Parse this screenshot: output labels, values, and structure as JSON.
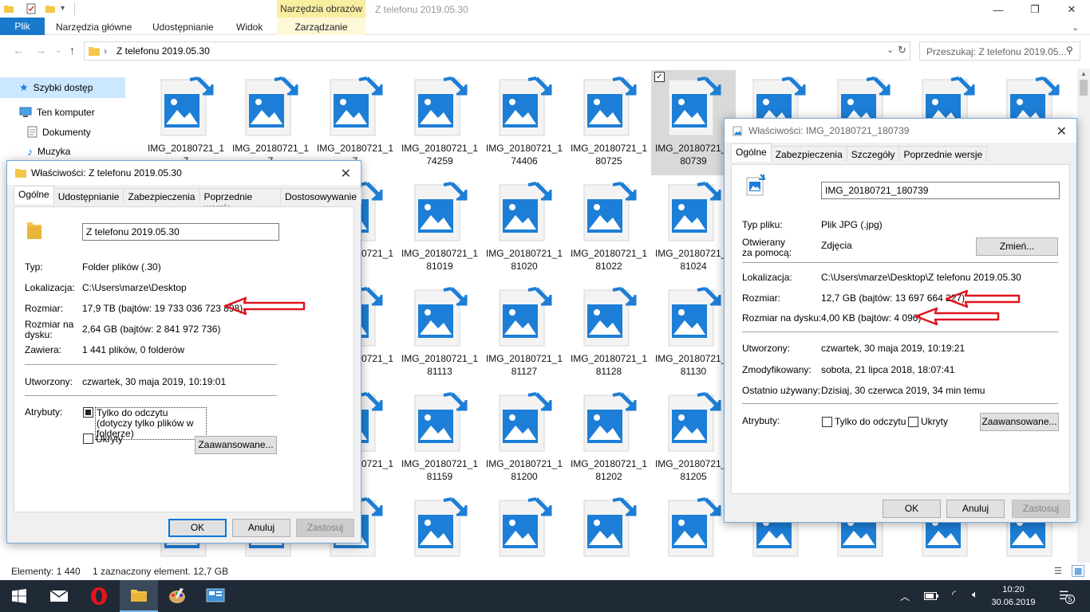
{
  "window": {
    "title": "Z telefonu 2019.05.30",
    "contextual_group": "Narzędzia obrazów",
    "contextual_tab": "Zarządzanie",
    "minimize": "—",
    "maximize": "❐",
    "close": "✕"
  },
  "ribbon": {
    "tabs": [
      "Plik",
      "Narzędzia główne",
      "Udostępnianie",
      "Widok"
    ]
  },
  "nav": {
    "address": "Z telefonu 2019.05.30",
    "search_placeholder": "Przeszukaj: Z telefonu 2019.05..."
  },
  "sidebar": {
    "items": [
      "Szybki dostęp",
      "Ten komputer",
      "Dokumenty",
      "Muzyka"
    ]
  },
  "files": [
    [
      "IMG_20180721_17",
      "IMG_20180721_17",
      "IMG_20180721_17",
      "IMG_20180721_174259",
      "IMG_20180721_174406",
      "IMG_20180721_180725",
      "IMG_20180721_180739",
      "",
      "",
      "",
      ""
    ],
    [
      "",
      "",
      "",
      "IMG_20180721_181019",
      "IMG_20180721_181020",
      "IMG_20180721_181022",
      "IMG_20180721_181024",
      "",
      "",
      "",
      ""
    ],
    [
      "",
      "",
      "",
      "IMG_20180721_181113",
      "IMG_20180721_181127",
      "IMG_20180721_181128",
      "IMG_20180721_181130",
      "",
      "",
      "",
      ""
    ],
    [
      "",
      "",
      "",
      "IMG_20180721_181159",
      "IMG_20180721_181200",
      "IMG_20180721_181202",
      "IMG_20180721_181205",
      "",
      "",
      "",
      ""
    ],
    [
      "",
      "",
      "",
      "",
      "",
      "",
      "",
      "",
      "",
      "",
      ""
    ]
  ],
  "partial_names": {
    "row2": "IMG_20180721_18",
    "row3": "IMG_20180721_18",
    "row4": "IMG_20180721_18"
  },
  "status": {
    "count": "Elementy: 1 440",
    "selection": "1 zaznaczony element. 12,7 GB"
  },
  "taskbar": {
    "time": "10:20",
    "date": "30.06.2019",
    "notifications": "5"
  },
  "folder_dialog": {
    "title": "Właściwości: Z telefonu 2019.05.30",
    "tabs": [
      "Ogólne",
      "Udostępnianie",
      "Zabezpieczenia",
      "Poprzednie wersje",
      "Dostosowywanie"
    ],
    "name": "Z telefonu 2019.05.30",
    "type_label": "Typ:",
    "type_value": "Folder plików (.30)",
    "location_label": "Lokalizacja:",
    "location_value": "C:\\Users\\marze\\Desktop",
    "size_label": "Rozmiar:",
    "size_value": "17,9 TB (bajtów: 19 733 036 723 898)",
    "disk_size_label": "Rozmiar na dysku:",
    "disk_size_value": "2,64 GB (bajtów: 2 841 972 736)",
    "contains_label": "Zawiera:",
    "contains_value": "1 441 plików, 0 folderów",
    "created_label": "Utworzony:",
    "created_value": "czwartek, 30 maja 2019, 10:19:01",
    "attributes_label": "Atrybuty:",
    "readonly_label": "Tylko do odczytu (dotyczy tylko plików w folderze)",
    "hidden_label": "Ukryty",
    "advanced_button": "Zaawansowane...",
    "ok": "OK",
    "cancel": "Anuluj",
    "apply": "Zastosuj"
  },
  "file_dialog": {
    "title": "Właściwości: IMG_20180721_180739",
    "tabs": [
      "Ogólne",
      "Zabezpieczenia",
      "Szczegóły",
      "Poprzednie wersje"
    ],
    "name": "IMG_20180721_180739",
    "type_label": "Typ pliku:",
    "type_value": "Plik JPG (.jpg)",
    "opens_with_label": "Otwierany za pomocą:",
    "opens_with_value": "Zdjęcia",
    "change_button": "Zmień...",
    "location_label": "Lokalizacja:",
    "location_value": "C:\\Users\\marze\\Desktop\\Z telefonu 2019.05.30",
    "size_label": "Rozmiar:",
    "size_value": "12,7 GB (bajtów: 13 697 664 227)",
    "disk_size_label": "Rozmiar na dysku:",
    "disk_size_value": "4,00 KB (bajtów: 4 096)",
    "created_label": "Utworzony:",
    "created_value": "czwartek, 30 maja 2019, 10:19:21",
    "modified_label": "Zmodyfikowany:",
    "modified_value": "sobota, 21 lipca 2018, 18:07:41",
    "accessed_label": "Ostatnio używany:",
    "accessed_value": "Dzisiaj, 30 czerwca 2019, 34 min temu",
    "attributes_label": "Atrybuty:",
    "readonly_label": "Tylko do odczytu",
    "hidden_label": "Ukryty",
    "advanced_button": "Zaawansowane...",
    "ok": "OK",
    "cancel": "Anuluj",
    "apply": "Zastosuj"
  },
  "colors": {
    "accent": "#1979ca",
    "annotation_arrow": "#e0141e",
    "image_icon": "#1c7ed6"
  }
}
